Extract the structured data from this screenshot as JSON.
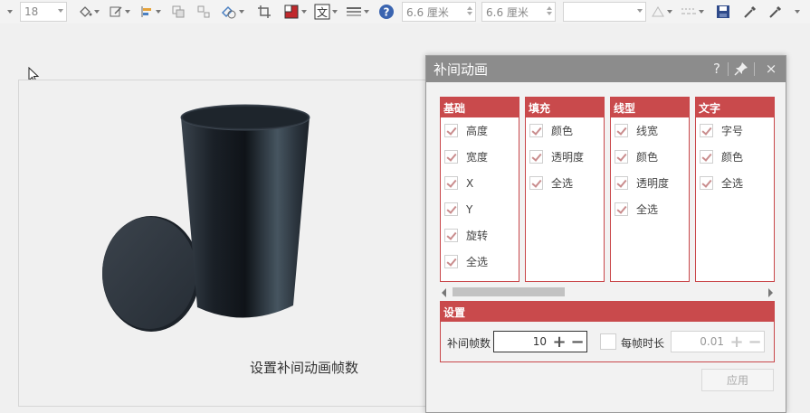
{
  "toolbar": {
    "font_size": "18",
    "width_value": "6.6 厘米",
    "height_value": "6.6 厘米",
    "style_value": ""
  },
  "caption": "设置补间动画帧数",
  "dialog": {
    "title": "补间动画",
    "help_label": "?",
    "close_label": "×",
    "columns": [
      {
        "title": "基础",
        "items": [
          "高度",
          "宽度",
          "X",
          "Y",
          "旋转",
          "全选"
        ]
      },
      {
        "title": "填充",
        "items": [
          "颜色",
          "透明度",
          "全选"
        ]
      },
      {
        "title": "线型",
        "items": [
          "线宽",
          "颜色",
          "透明度",
          "全选"
        ]
      },
      {
        "title": "文字",
        "items": [
          "字号",
          "颜色",
          "全选"
        ]
      }
    ],
    "settings": {
      "title": "设置",
      "frames_label": "补间帧数",
      "frames_value": "10",
      "per_frame_label": "每帧时长",
      "per_frame_value": "0.01",
      "per_frame_checked": false
    },
    "apply_label": "应用"
  },
  "colors": {
    "accent": "#c94a4c",
    "title_bar": "#8c8c8c",
    "cylinder": "#2b333c"
  }
}
